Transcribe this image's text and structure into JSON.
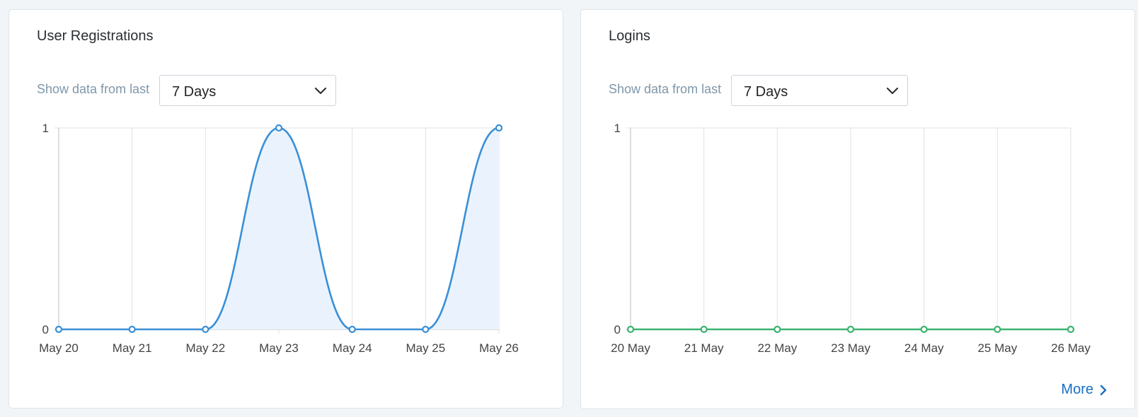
{
  "panels": [
    {
      "title": "User Registrations",
      "filter_label": "Show data from last",
      "filter_value": "7 Days"
    },
    {
      "title": "Logins",
      "filter_label": "Show data from last",
      "filter_value": "7 Days",
      "more_label": "More"
    }
  ],
  "colors": {
    "registrations_line": "#3a8fd6",
    "registrations_fill": "#eaf3fd",
    "logins_line": "#3cb371",
    "grid": "#e2e2e2",
    "axis": "#c8c8c8"
  },
  "icons": {
    "select_chevron": "chevron-down-icon",
    "more_chevron": "chevron-right-icon"
  },
  "chart_data": [
    {
      "type": "area",
      "categories": [
        "May 20",
        "May 21",
        "May 22",
        "May 23",
        "May 24",
        "May 25",
        "May 26"
      ],
      "series": [
        {
          "values": [
            0,
            0,
            0,
            1,
            0,
            0,
            1
          ]
        }
      ],
      "yticks": [
        "0",
        "1"
      ],
      "ylim": [
        0,
        1
      ],
      "grid": true,
      "smooth": true
    },
    {
      "type": "line",
      "categories": [
        "20 May",
        "21 May",
        "22 May",
        "23 May",
        "24 May",
        "25 May",
        "26 May"
      ],
      "series": [
        {
          "values": [
            0,
            0,
            0,
            0,
            0,
            0,
            0
          ]
        }
      ],
      "yticks": [
        "0",
        "1"
      ],
      "ylim": [
        0,
        1
      ],
      "grid": true
    }
  ]
}
